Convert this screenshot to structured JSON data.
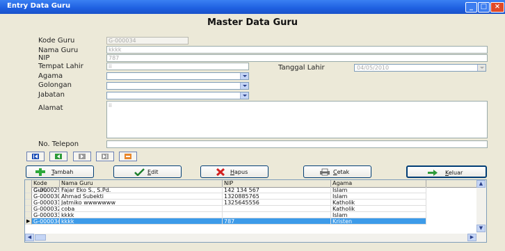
{
  "window": {
    "title": "Entry Data Guru",
    "minimize": "_",
    "maximize": "□",
    "close": "×"
  },
  "heading": "Master Data Guru",
  "form": {
    "kode_guru": {
      "label": "Kode Guru",
      "value": "G-000034"
    },
    "nama_guru": {
      "label": "Nama Guru",
      "value": "kkkk"
    },
    "nip": {
      "label": "NIP",
      "value": "787"
    },
    "tempat_lahir": {
      "label": "Tempat Lahir",
      "value": "ii"
    },
    "tanggal_lahir": {
      "label": "Tanggal Lahir",
      "value": "04/05/2010"
    },
    "agama": {
      "label": "Agama",
      "value": ""
    },
    "golongan": {
      "label": "Golongan",
      "value": ""
    },
    "jabatan": {
      "label": "Jabatan",
      "value": ""
    },
    "alamat": {
      "label": "Alamat",
      "value": "ii"
    },
    "no_telepon": {
      "label": "No. Telepon",
      "value": ""
    }
  },
  "navigation": [
    {
      "name": "first-record-button",
      "icon": "first-icon"
    },
    {
      "name": "previous-record-button",
      "icon": "previous-icon"
    },
    {
      "name": "next-record-button",
      "icon": "next-icon"
    },
    {
      "name": "last-record-button",
      "icon": "last-icon"
    },
    {
      "name": "refresh-button",
      "icon": "refresh-icon"
    }
  ],
  "actions": {
    "tambah": {
      "hotkey": "T",
      "rest": "ambah",
      "icon": "plus-icon"
    },
    "edit": {
      "hotkey": "E",
      "rest": "dit",
      "icon": "check-icon"
    },
    "hapus": {
      "hotkey": "H",
      "rest": "apus",
      "icon": "delete-icon"
    },
    "cetak": {
      "hotkey": "C",
      "rest": "etak",
      "icon": "printer-icon"
    },
    "keluar": {
      "hotkey": "K",
      "rest": "eluar",
      "icon": "exit-arrow-icon"
    }
  },
  "colors": {
    "title_bar": "#1E5FE0",
    "selected_row": "#3D9BE9",
    "window_bg": "#ECE9D8"
  },
  "grid": {
    "columns": [
      "Kode Guru",
      "Nama Guru",
      "NIP",
      "Agama"
    ],
    "rows": [
      {
        "kode": "G-000029",
        "nama": "Fajar Eko S., S.Pd.",
        "nip": "142 134 567",
        "agama": "Islam"
      },
      {
        "kode": "G-000030",
        "nama": "Ahmad Subekti",
        "nip": "1320885765",
        "agama": "Islam"
      },
      {
        "kode": "G-000031",
        "nama": "Jatmiko wwwwwww",
        "nip": "1325645556",
        "agama": "Katholik"
      },
      {
        "kode": "G-000032",
        "nama": "coba",
        "nip": "",
        "agama": "Katholik"
      },
      {
        "kode": "G-000033",
        "nama": "kkkk",
        "nip": "",
        "agama": "Islam"
      },
      {
        "kode": "G-000034",
        "nama": "kkkk",
        "nip": "787",
        "agama": "Kristen",
        "selected": true
      }
    ],
    "current_row_marker": "▶"
  }
}
